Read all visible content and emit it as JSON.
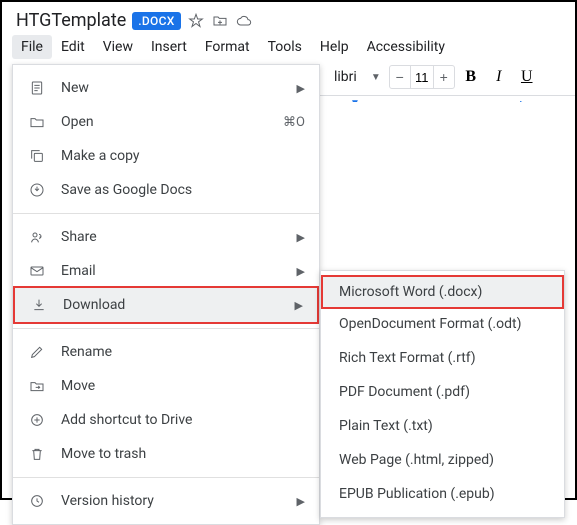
{
  "title": "HTGTemplate",
  "badge": ".DOCX",
  "menubar": [
    "File",
    "Edit",
    "View",
    "Insert",
    "Format",
    "Tools",
    "Help",
    "Accessibility"
  ],
  "toolbar": {
    "font": "libri",
    "size": "11"
  },
  "file_menu": {
    "new": "New",
    "open": "Open",
    "open_shortcut": "⌘O",
    "make_copy": "Make a copy",
    "save_gdocs": "Save as Google Docs",
    "share": "Share",
    "email": "Email",
    "download": "Download",
    "rename": "Rename",
    "move": "Move",
    "add_shortcut": "Add shortcut to Drive",
    "trash": "Move to trash",
    "version": "Version history"
  },
  "download_menu": {
    "docx": "Microsoft Word (.docx)",
    "odt": "OpenDocument Format (.odt)",
    "rtf": "Rich Text Format (.rtf)",
    "pdf": "PDF Document (.pdf)",
    "txt": "Plain Text (.txt)",
    "html": "Web Page (.html, zipped)",
    "epub": "EPUB Publication (.epub)"
  }
}
